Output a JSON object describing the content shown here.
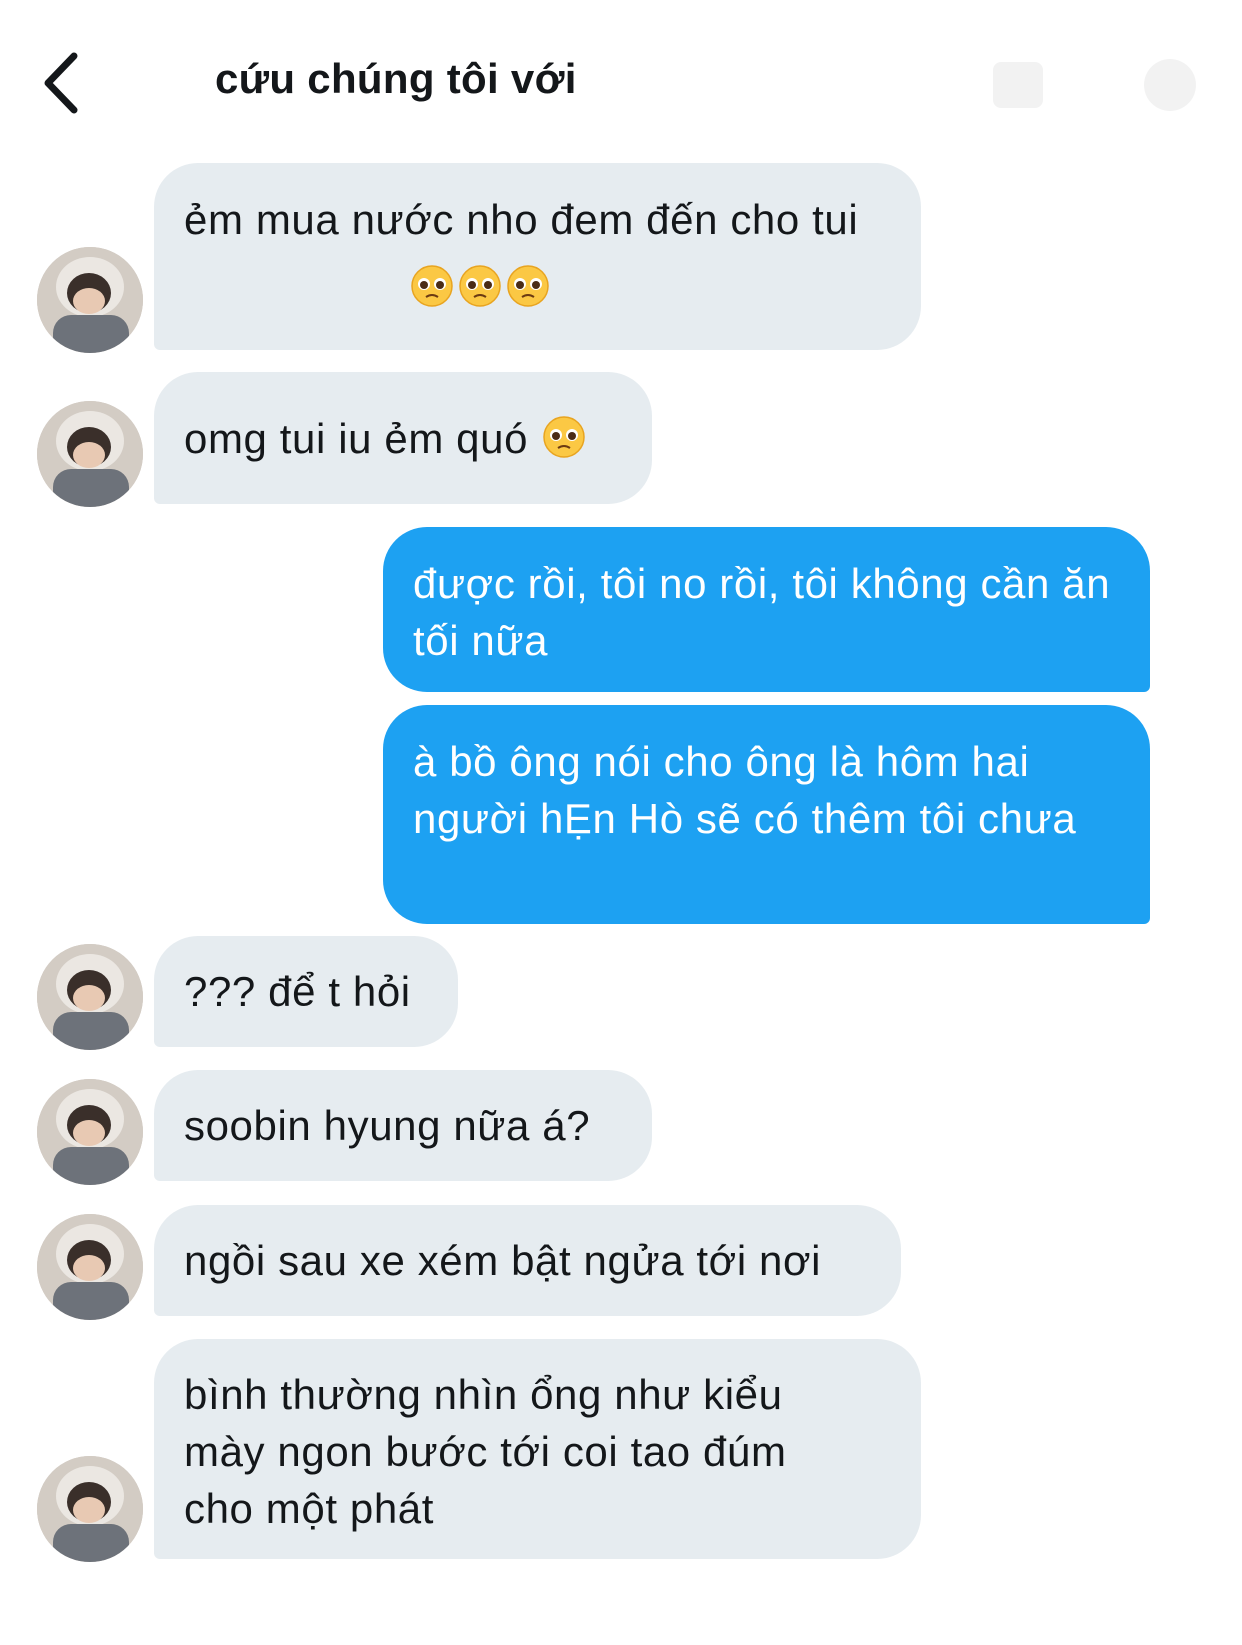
{
  "header": {
    "title": "cứu chúng tôi với",
    "back_icon": "chevron-left-icon",
    "right_icons": [
      "new-message-icon",
      "settings-icon"
    ]
  },
  "colors": {
    "incoming_bubble": "#e6ecf0",
    "outgoing_bubble": "#1da1f2",
    "outgoing_text": "#ffffff",
    "text": "#14171a"
  },
  "messages": [
    {
      "direction": "incoming",
      "text": "ẻm mua nước nho đem đến cho tui",
      "emoji": [
        "pleading-face-icon",
        "pleading-face-icon",
        "pleading-face-icon"
      ]
    },
    {
      "direction": "incoming",
      "text": "omg tui iu ẻm quó",
      "emoji": [
        "pleading-face-icon"
      ]
    },
    {
      "direction": "outgoing",
      "text": "được rồi, tôi no rồi, tôi không cần ăn tối nữa"
    },
    {
      "direction": "outgoing",
      "text": "à bồ ông nói cho ông là hôm hai người hẸn Hò sẽ có thêm tôi chưa"
    },
    {
      "direction": "incoming",
      "text": "??? để t hỏi"
    },
    {
      "direction": "incoming",
      "text": "soobin hyung nữa á?"
    },
    {
      "direction": "incoming",
      "text": "ngồi sau xe xém bật ngửa tới nơi"
    },
    {
      "direction": "incoming",
      "text": "bình thường nhìn ổng như kiểu mày ngon bước tới coi tao đúm cho một phát"
    }
  ]
}
